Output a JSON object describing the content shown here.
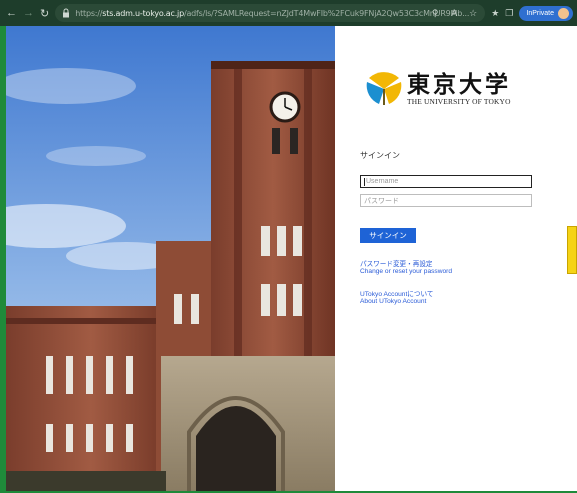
{
  "browser": {
    "url_prefix": "https://",
    "url_host": "sts.adm.u-tokyo.ac.jp",
    "url_path": "/adfs/ls/?SAMLRequest=nZJdT4MwFIb%2FCuk9FNjA2Qw53C3cMnUR9Mb...",
    "inprivate_label": "InPrivate"
  },
  "login": {
    "logo_jp": "東京大学",
    "logo_en": "THE UNIVERSITY OF TOKYO",
    "heading": "サインイン",
    "username_placeholder": "Username",
    "password_placeholder": "パスワード",
    "signin_button": "サインイン",
    "links": [
      {
        "label": "パスワード変更・再設定"
      },
      {
        "label": "Change or reset your password"
      },
      {
        "label": "UTokyo Accountについて"
      },
      {
        "label": "About UTokyo Account"
      }
    ]
  },
  "colors": {
    "accent": "#1e63d6",
    "link": "#2a5bd7",
    "frame": "#1f8a3a",
    "logo_gold": "#f2b705"
  }
}
